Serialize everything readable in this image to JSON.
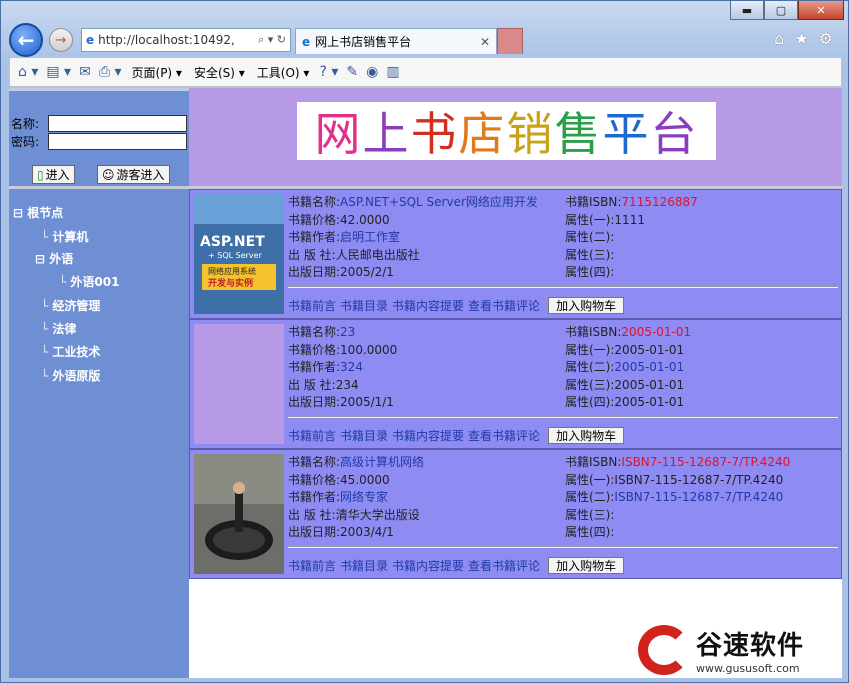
{
  "browser": {
    "address": "http://localhost:10492,",
    "tab_title": "网上书店销售平台",
    "menus": [
      "页面(P) ▾",
      "安全(S) ▾",
      "工具(O) ▾"
    ],
    "window_controls": [
      "▬",
      "▢",
      "✕"
    ]
  },
  "login": {
    "name_label": "名称:",
    "password_label": "密码:",
    "enter_button": "进入",
    "guest_button": "游客进入"
  },
  "banner": {
    "title_chars": [
      "网",
      "上",
      "书",
      "店",
      "销",
      "售",
      "平",
      "台"
    ],
    "title_colors": [
      "#e0308a",
      "#8a3dc0",
      "#d0301e",
      "#e07a1a",
      "#c8a21a",
      "#2aa04a",
      "#1a6ad0",
      "#8a3dc0"
    ]
  },
  "tree": {
    "root": "根节点",
    "items": [
      {
        "label": "计算机"
      },
      {
        "label": "外语",
        "expanded": true,
        "children": [
          {
            "label": "外语001"
          }
        ]
      },
      {
        "label": "经济管理"
      },
      {
        "label": "法律"
      },
      {
        "label": "工业技术"
      },
      {
        "label": "外语原版"
      }
    ]
  },
  "labels": {
    "name": "书籍名称:",
    "price": "书籍价格:",
    "author": "书籍作者:",
    "publisher": "出 版 社:",
    "date": "出版日期:",
    "isbn": "书籍ISBN:",
    "attr1": "属性(一):",
    "attr2": "属性(二):",
    "attr3": "属性(三):",
    "attr4": "属性(四):"
  },
  "actions": {
    "preface": "书籍前言",
    "toc": "书籍目录",
    "summary": "书籍内容提要",
    "comments": "查看书籍评论",
    "add_cart": "加入购物车"
  },
  "books": [
    {
      "name": "ASP.NET+SQL Server网络应用开发",
      "price": "42.0000",
      "author": "启明工作室",
      "publisher": "人民邮电出版社",
      "date": "2005/2/1",
      "isbn": "7115126887",
      "attr1": "1111",
      "attr2": "",
      "attr3": "",
      "attr4": "",
      "cover": {
        "line1": "ASP.NET",
        "line2": "+ SQL Server",
        "line3": "网络应用系统",
        "line4": "开发与实例"
      }
    },
    {
      "name": "23",
      "price": "100.0000",
      "author": "324",
      "publisher": "234",
      "date": "2005/1/1",
      "isbn": "2005-01-01",
      "attr1": "2005-01-01",
      "attr2": "2005-01-01",
      "attr3": "2005-01-01",
      "attr4": "2005-01-01"
    },
    {
      "name": "高级计算机网络",
      "price": "45.0000",
      "author": "网络专家",
      "publisher": "清华大学出版设",
      "date": "2003/4/1",
      "isbn": "ISBN7-115-12687-7/TP.4240",
      "attr1": "ISBN7-115-12687-7/TP.4240",
      "attr2": "ISBN7-115-12687-7/TP.4240",
      "attr3": "",
      "attr4": ""
    }
  ],
  "watermark": {
    "brand": "谷速软件",
    "url": "www.gususoft.com"
  }
}
